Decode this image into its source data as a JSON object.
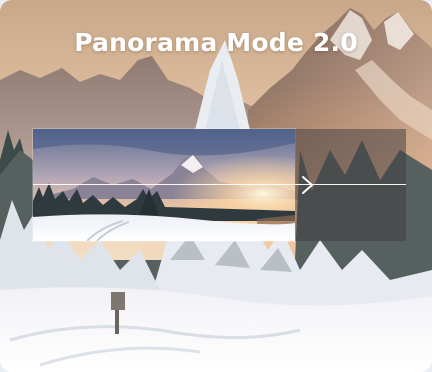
{
  "app": {
    "title": "Panorama Mode 2.0"
  },
  "capture": {
    "progress": 0.7,
    "direction": "left-to-right"
  },
  "icons": {
    "direction_arrow": "chevron-right-icon"
  },
  "colors": {
    "title_text": "#ffffff",
    "guide_line": "#ffffff",
    "pending_overlay": "#3c3a3e"
  }
}
